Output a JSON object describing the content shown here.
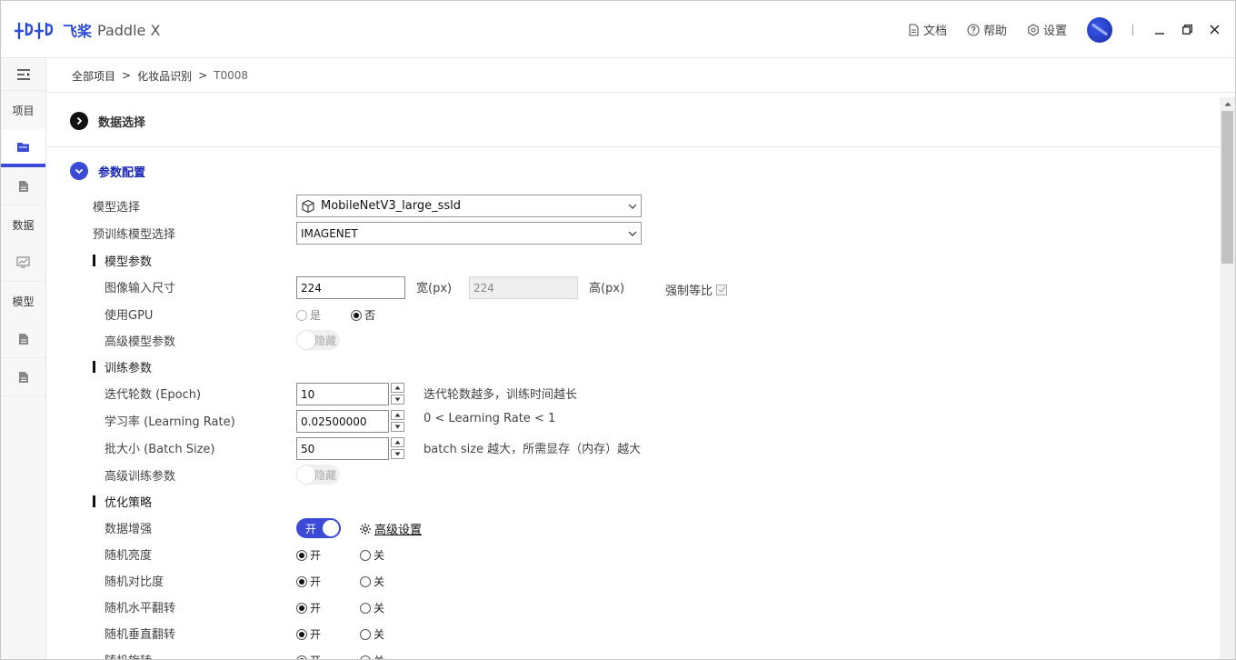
{
  "app": {
    "logo_mark": "ꟻ꠸ꟻ",
    "logo_cn": "飞桨",
    "logo_en": "Paddle X"
  },
  "topbar": {
    "docs": "文档",
    "help": "帮助",
    "settings": "设置"
  },
  "sidenav": {
    "project": "项目",
    "data": "数据",
    "model": "模型"
  },
  "breadcrumb": {
    "all_projects": "全部项目",
    "project": "化妆品识别",
    "task": "T0008",
    "sep": ">"
  },
  "sections": {
    "data_select": "数据选择",
    "param_config": "参数配置"
  },
  "form": {
    "model_select_label": "模型选择",
    "model_select_value": "MobileNetV3_large_ssld",
    "pretrain_label": "预训练模型选择",
    "pretrain_value": "IMAGENET",
    "model_params": "模型参数",
    "image_size_label": "图像输入尺寸",
    "width_value": "224",
    "width_unit": "宽(px)",
    "height_value": "224",
    "height_unit": "高(px)",
    "keep_ratio": "强制等比",
    "gpu_label": "使用GPU",
    "gpu_yes": "是",
    "gpu_no": "否",
    "adv_model_label": "高级模型参数",
    "hide": "隐藏",
    "train_params": "训练参数",
    "epoch_label": "迭代轮数 (Epoch)",
    "epoch_value": "10",
    "epoch_hint": "迭代轮数越多，训练时间越长",
    "lr_label": "学习率 (Learning Rate)",
    "lr_value": "0.02500000",
    "lr_hint": "0 < Learning Rate < 1",
    "bs_label": "批大小 (Batch Size)",
    "bs_value": "50",
    "bs_hint": "batch size 越大，所需显存（内存）越大",
    "adv_train_label": "高级训练参数",
    "opt_strategy": "优化策略",
    "aug_label": "数据增强",
    "aug_on": "开",
    "adv_settings": "高级设置",
    "on": "开",
    "off": "关",
    "brightness": "随机亮度",
    "contrast": "随机对比度",
    "hflip": "随机水平翻转",
    "vflip": "随机垂直翻转",
    "rotate": "随机旋转"
  },
  "colors": {
    "accent": "#3b4bd8",
    "logo": "#2b4bd8"
  }
}
